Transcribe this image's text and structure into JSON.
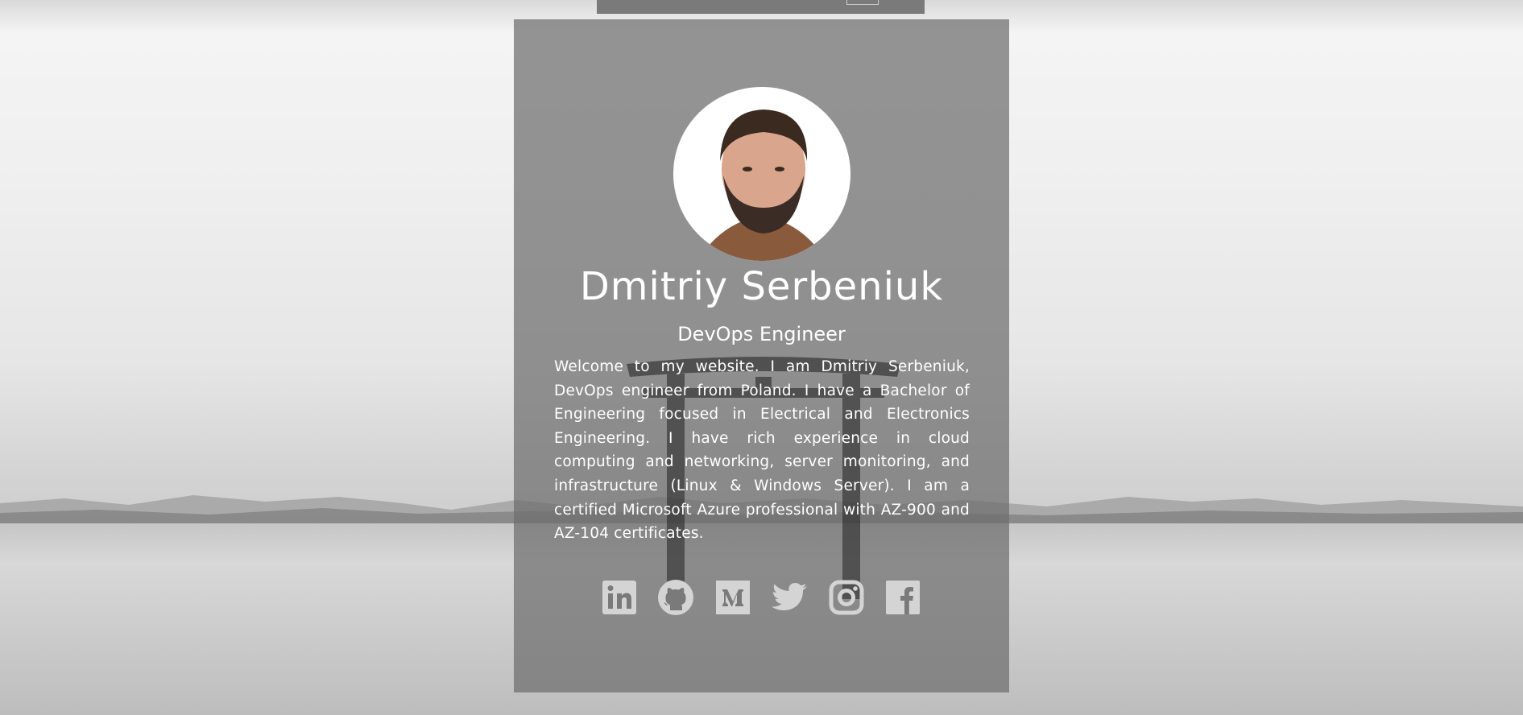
{
  "profile": {
    "name": "Dmitriy Serbeniuk",
    "role": "DevOps Engineer",
    "bio": "Welcome to my website. I am Dmitriy Serbeniuk, DevOps engineer from Poland. I have a Bachelor of Engineering focused in Electrical and Electronics Engineering. I have rich experience in cloud computing and networking, server monitoring, and infrastructure (Linux & Windows Server). I am a certified Microsoft Azure professional with AZ-900 and AZ-104 certificates."
  },
  "social": [
    {
      "icon": "linkedin-icon"
    },
    {
      "icon": "github-icon"
    },
    {
      "icon": "medium-icon"
    },
    {
      "icon": "twitter-icon"
    },
    {
      "icon": "instagram-icon"
    },
    {
      "icon": "facebook-icon"
    }
  ],
  "colors": {
    "card": "#6e6e6e",
    "text": "#ffffff",
    "icon": "#d4d4d4"
  }
}
